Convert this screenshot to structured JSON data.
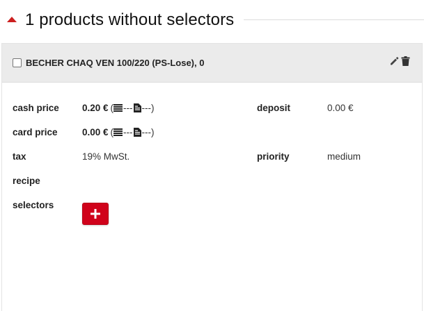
{
  "section": {
    "title": "1 products without selectors",
    "caret_icon": "caret-up-icon",
    "accent": "#cc1f1f"
  },
  "product": {
    "name": "BECHER CHAQ VEN 100/220 (PS-Lose), 0",
    "checked": false,
    "actions": {
      "edit_icon": "pencil-icon",
      "delete_icon": "trash-icon"
    }
  },
  "details": {
    "cash_price": {
      "label": "cash price",
      "amount": "0.20 €",
      "open": "(",
      "sep1": "---",
      "sep2": "---)"
    },
    "card_price": {
      "label": "card price",
      "amount": "0.00 €",
      "open": "(",
      "sep1": "---",
      "sep2": "---)"
    },
    "deposit": {
      "label": "deposit",
      "value": "0.00 €"
    },
    "tax": {
      "label": "tax",
      "value": "19% MwSt."
    },
    "priority": {
      "label": "priority",
      "value": "medium"
    },
    "recipe": {
      "label": "recipe",
      "value": ""
    },
    "selectors": {
      "label": "selectors",
      "add_icon": "plus-icon",
      "add_color": "#d0021b"
    }
  }
}
